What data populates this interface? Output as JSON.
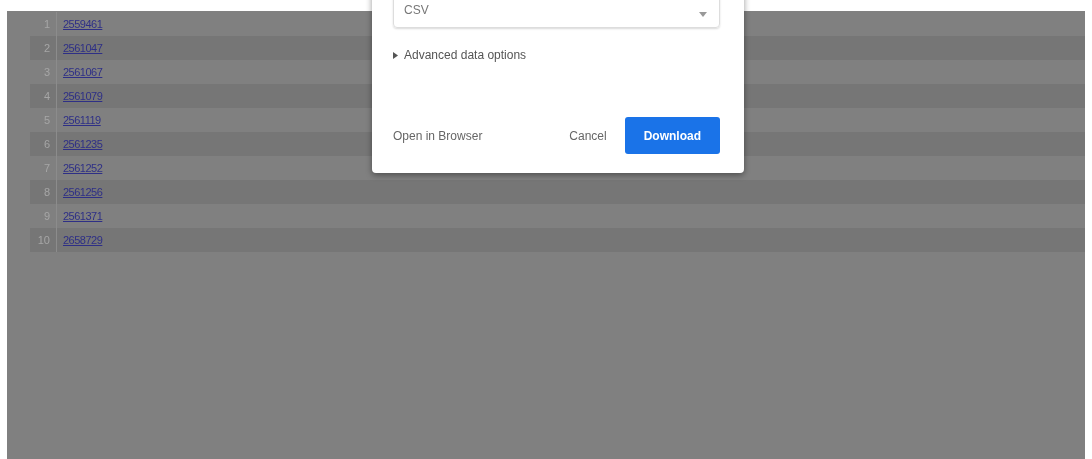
{
  "table": {
    "rows": [
      {
        "index": "1",
        "id": "2559461"
      },
      {
        "index": "2",
        "id": "2561047"
      },
      {
        "index": "3",
        "id": "2561067"
      },
      {
        "index": "4",
        "id": "2561079"
      },
      {
        "index": "5",
        "id": "2561119"
      },
      {
        "index": "6",
        "id": "2561235"
      },
      {
        "index": "7",
        "id": "2561252"
      },
      {
        "index": "8",
        "id": "2561256"
      },
      {
        "index": "9",
        "id": "2561371"
      },
      {
        "index": "10",
        "id": "2658729"
      }
    ]
  },
  "dialog": {
    "format_select": {
      "value": "CSV"
    },
    "advanced_options": {
      "label": "Advanced data options",
      "expanded": false
    },
    "buttons": [
      {
        "label": "Open in Browser",
        "kind": "text"
      },
      {
        "label": "Cancel",
        "kind": "text"
      },
      {
        "label": "Download",
        "kind": "primary"
      }
    ]
  }
}
